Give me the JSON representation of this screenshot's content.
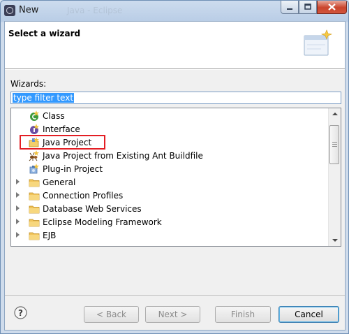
{
  "window": {
    "title": "New",
    "ghost_title": "Java  -  Eclipse"
  },
  "header": {
    "title": "Select a wizard"
  },
  "wizards": {
    "label": "Wizards:",
    "filter_value": "type filter text"
  },
  "tree": {
    "items": [
      {
        "label": "Class",
        "icon": "class-icon",
        "type": "leaf"
      },
      {
        "label": "Interface",
        "icon": "interface-icon",
        "type": "leaf"
      },
      {
        "label": "Java Project",
        "icon": "java-project-icon",
        "type": "leaf",
        "highlighted": true
      },
      {
        "label": "Java Project from Existing Ant Buildfile",
        "icon": "ant-project-icon",
        "type": "leaf"
      },
      {
        "label": "Plug-in Project",
        "icon": "plugin-project-icon",
        "type": "leaf"
      },
      {
        "label": "General",
        "icon": "folder-icon",
        "type": "folder"
      },
      {
        "label": "Connection Profiles",
        "icon": "folder-icon",
        "type": "folder"
      },
      {
        "label": "Database Web Services",
        "icon": "folder-icon",
        "type": "folder"
      },
      {
        "label": "Eclipse Modeling Framework",
        "icon": "folder-icon",
        "type": "folder"
      },
      {
        "label": "EJB",
        "icon": "folder-icon",
        "type": "folder"
      }
    ]
  },
  "buttons": {
    "help": "?",
    "back": "< Back",
    "next": "Next >",
    "finish": "Finish",
    "cancel": "Cancel"
  },
  "colors": {
    "highlight_border": "#e31e24",
    "selection": "#3399ff",
    "close_button": "#c9442c"
  }
}
